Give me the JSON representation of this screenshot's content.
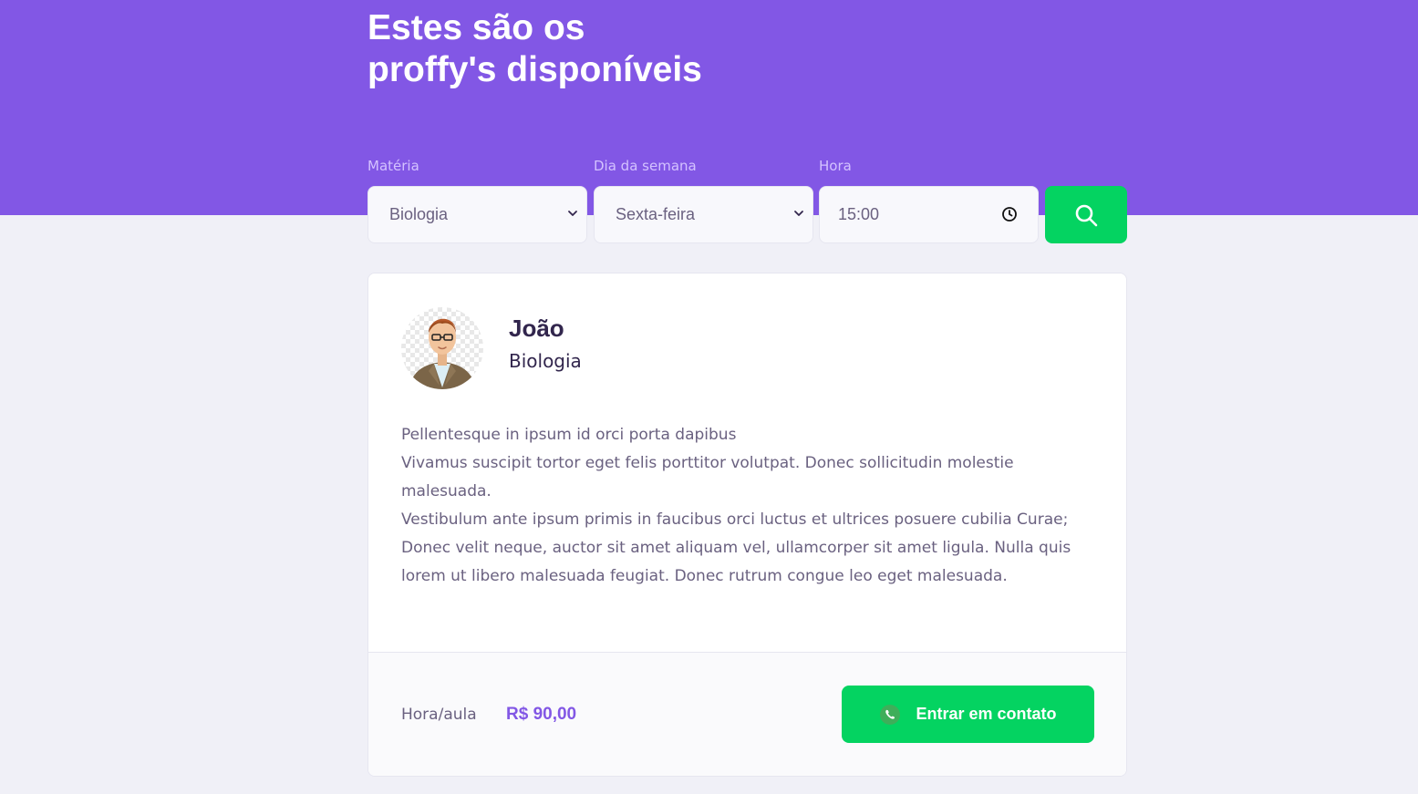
{
  "header": {
    "title_line1": "Estes são os",
    "title_line2": "proffy's disponíveis"
  },
  "filters": {
    "subject": {
      "label": "Matéria",
      "value": "Biologia"
    },
    "week_day": {
      "label": "Dia da semana",
      "value": "Sexta-feira"
    },
    "time": {
      "label": "Hora",
      "value": "15:00"
    }
  },
  "teacher": {
    "name": "João",
    "subject": "Biologia",
    "bio": [
      "Pellentesque in ipsum id orci porta dapibus",
      "Vivamus suscipit tortor eget felis porttitor volutpat. Donec sollicitudin molestie malesuada.",
      "Vestibulum ante ipsum primis in faucibus orci luctus et ultrices posuere cubilia Curae; Donec velit neque, auctor sit amet aliquam vel, ullamcorper sit amet ligula. Nulla quis lorem ut libero malesuada feugiat. Donec rutrum congue leo eget malesuada."
    ],
    "price_label": "Hora/aula",
    "price_value": "R$ 90,00",
    "contact_label": "Entrar em contato"
  },
  "colors": {
    "primary": "#8257E5",
    "secondary": "#04D361",
    "background": "#F0F0F7"
  },
  "icons": {
    "search": "search-icon",
    "whatsapp": "whatsapp-icon",
    "clock": "clock-icon",
    "chevron": "chevron-down-icon"
  }
}
